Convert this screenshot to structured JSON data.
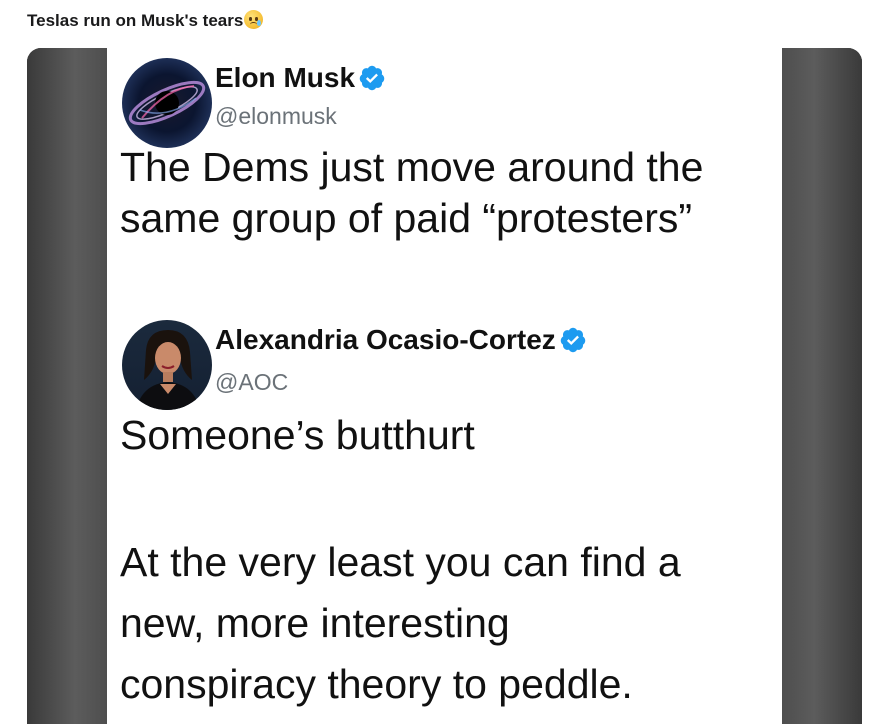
{
  "post": {
    "title": "Teslas run on Musk's tears",
    "title_emoji": "sad-tear-emoji-icon"
  },
  "colors": {
    "verified_badge": "#1d9bf0",
    "handle_gray": "#6b7278",
    "text": "#111111"
  },
  "tweets": [
    {
      "name": "Elon Musk",
      "handle": "@elonmusk",
      "verified": true,
      "avatar": "galaxy-avatar-icon",
      "text_lines": [
        "The Dems just move around the",
        "same group of paid “protesters”"
      ]
    },
    {
      "name": "Alexandria Ocasio-Cortez",
      "handle": "@AOC",
      "verified": true,
      "avatar": "portrait-avatar-icon",
      "text_lines": [
        "Someone’s butthurt",
        "",
        "At the very least you can find a",
        "new, more interesting",
        "conspiracy theory to peddle."
      ]
    }
  ]
}
